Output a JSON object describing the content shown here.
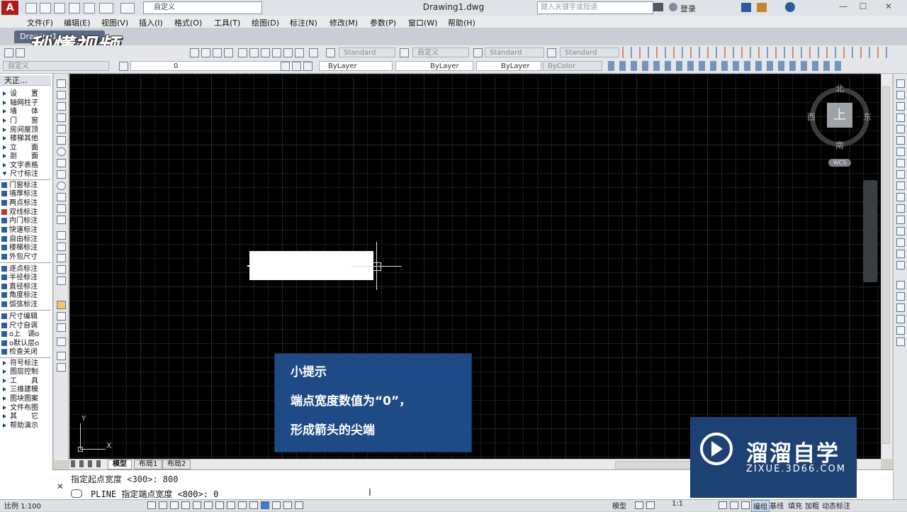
{
  "app": {
    "logo": "A",
    "doc_title": "Drawing1.dwg",
    "workspace": "自定义",
    "search_placeholder": "键入关键字或短语",
    "login": "登录",
    "window_buttons": [
      "—",
      "☐",
      "✕"
    ]
  },
  "menu": [
    "文件(F)",
    "编辑(E)",
    "视图(V)",
    "插入(I)",
    "格式(O)",
    "工具(T)",
    "绘图(D)",
    "标注(N)",
    "修改(M)",
    "参数(P)",
    "窗口(W)",
    "帮助(H)"
  ],
  "doc_tab": "Drawing1",
  "watermark_logo": "秒懂视频",
  "toolbar": {
    "text_style": "Standard",
    "dim_style": "自定义",
    "table_style": "Standard",
    "multileader_style": "Standard",
    "workspace2": "自定义",
    "layer": "0",
    "color": "ByLayer",
    "linetype": "ByLayer",
    "lineweight": "ByLayer",
    "plotstyle": "ByColor"
  },
  "palette": {
    "title": "天正...",
    "group1": [
      "设　　置",
      "轴网柱子",
      "墙　　体",
      "门　　窗",
      "房间屋顶",
      "楼梯其他",
      "立　　面",
      "剖　　面",
      "文字表格",
      "尺寸标注"
    ],
    "group2": [
      "门窗标注",
      "墙厚标注",
      "两点标注",
      "双线标注",
      "内门标注",
      "快速标注",
      "自由标注",
      "楼梯标注",
      "外包尺寸"
    ],
    "group3": [
      "逐点标注",
      "半径标注",
      "直径标注",
      "角度标注",
      "弧弦标注"
    ],
    "group4": [
      "尺寸编辑",
      "尺寸自调",
      "o上　调o",
      "o默认层o",
      "检查关闭"
    ],
    "group5": [
      "符号标注",
      "图层控制",
      "工　　具",
      "三维建模",
      "图块图案",
      "文件布图",
      "其　　它",
      "帮助演示"
    ]
  },
  "viewcube": {
    "top": "上",
    "north": "北",
    "south": "南",
    "east": "东",
    "west": "西",
    "wcs": "WCS"
  },
  "ucs": {
    "x": "X",
    "y": "Y"
  },
  "layout_tabs": [
    "模型",
    "布局1",
    "布局2"
  ],
  "command": {
    "history": "指定起点宽度 <300>: 800",
    "current": "PLINE 指定端点宽度 <800>: 0",
    "close": "✕"
  },
  "status": {
    "scale": "比例 1:100",
    "model": "模型",
    "zoom": "1:1",
    "flags": [
      "编组",
      "基线",
      "填充",
      "加粗",
      "动态标注"
    ]
  },
  "tip": {
    "title": "小提示",
    "line1": "端点宽度数值为“0”，",
    "line2": "形成箭头的尖端"
  },
  "brand": {
    "name": "溜溜自学",
    "site": "ZIXUE.3D66.COM"
  }
}
